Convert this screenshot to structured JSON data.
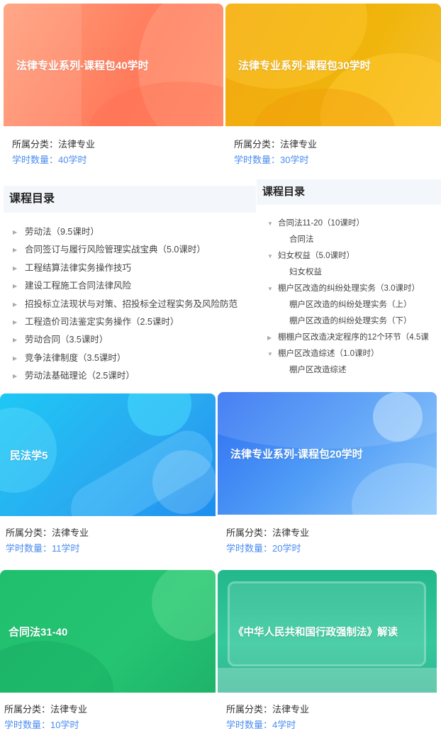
{
  "cards": [
    {
      "title": "法律专业系列-课程包40学时",
      "category": "所属分类：法律专业",
      "hours": "学时数量：40学时"
    },
    {
      "title": "法律专业系列-课程包30学时",
      "category": "所属分类：法律专业",
      "hours": "学时数量：30学时"
    },
    {
      "title": "民法学5",
      "category": "所属分类：法律专业",
      "hours": "学时数量：11学时"
    },
    {
      "title": "法律专业系列-课程包20学时",
      "category": "所属分类：法律专业",
      "hours": "学时数量：20学时"
    },
    {
      "title": "合同法31-40",
      "category": "所属分类：法律专业",
      "hours": "学时数量：10学时"
    },
    {
      "title": "《中华人民共和国行政强制法》解读",
      "category": "所属分类：法律专业",
      "hours": "学时数量：4学时"
    }
  ],
  "catalog_left": {
    "heading": "课程目录",
    "items": [
      "劳动法（9.5课时）",
      "合同签订与履行风险管理实战宝典（5.0课时）",
      "工程结算法律实务操作技巧",
      "建设工程施工合同法律风险",
      "招投标立法现状与对策、招投标全过程实务及风险防范",
      "工程造价司法鉴定实务操作（2.5课时）",
      "劳动合同（3.5课时）",
      "竞争法律制度（3.5课时）",
      "劳动法基础理论（2.5课时）"
    ]
  },
  "catalog_right": {
    "heading": "课程目录",
    "items": [
      {
        "label": "合同法11-20（10课时）",
        "expanded": true
      },
      {
        "label": "合同法",
        "child": true
      },
      {
        "label": "妇女权益（5.0课时）",
        "expanded": true
      },
      {
        "label": "妇女权益",
        "child": true
      },
      {
        "label": "棚户区改造的纠纷处理实务（3.0课时）",
        "expanded": true
      },
      {
        "label": "棚户区改造的纠纷处理实务（上）",
        "child": true
      },
      {
        "label": "棚户区改造的纠纷处理实务（下）",
        "child": true
      },
      {
        "label": "棚棚户区改造决定程序的12个环节（4.5课",
        "expanded": false
      },
      {
        "label": "棚户区改造综述（1.0课时）",
        "expanded": true
      },
      {
        "label": "棚户区改造综述",
        "child": true
      }
    ]
  },
  "icons": {
    "collapsed": "caret-right-icon",
    "expanded": "caret-down-icon"
  }
}
